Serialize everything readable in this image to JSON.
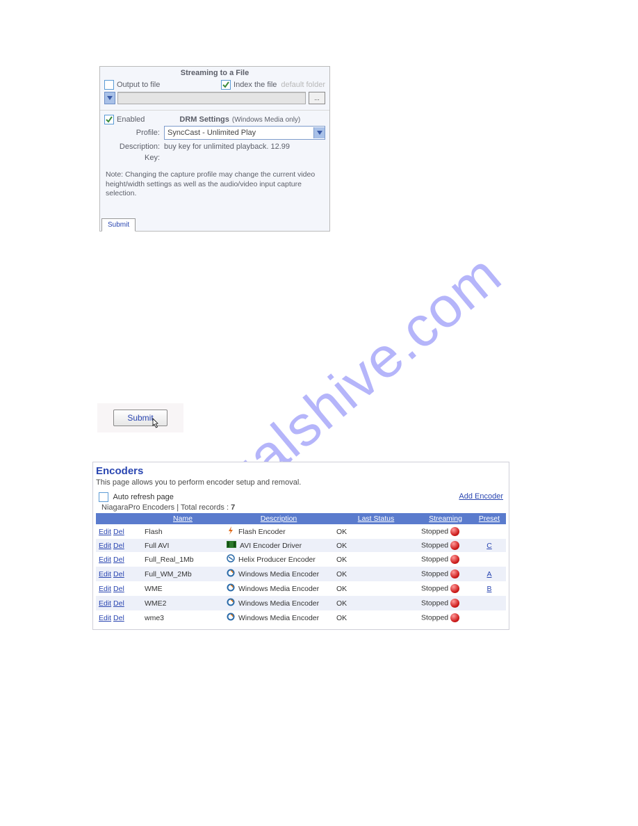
{
  "watermark": "manualshive.com",
  "streamPanel": {
    "title": "Streaming to a File",
    "outputToFile": {
      "label": "Output to file",
      "checked": false
    },
    "indexFile": {
      "label": "Index the file",
      "checked": true
    },
    "defaultFolder": "default folder",
    "browseLabel": "...",
    "enabled": {
      "label": "Enabled",
      "checked": true
    },
    "drmTitle": "DRM Settings",
    "drmSub": "(Windows Media only)",
    "profileLabel": "Profile:",
    "profileValue": "SyncCast - Unlimited Play",
    "descLabel": "Description:",
    "descValue": "buy key for unlimited playback. 12.99",
    "keyLabel": "Key:",
    "keyValue": "",
    "note": "Note: Changing the capture profile may change the current video height/width settings as well as the audio/video input capture selection.",
    "submit": "Submit"
  },
  "submitBtn": {
    "label": "Submit"
  },
  "encodersPanel": {
    "title": "Encoders",
    "subtitle": "This page allows you to perform encoder setup and removal.",
    "autoRefresh": "Auto refresh page",
    "addEncoder": "Add Encoder",
    "totalsPrefix": "NiagaraPro Encoders | Total records : ",
    "totalRecords": "7",
    "headers": {
      "name": "Name",
      "description": "Description",
      "lastStatus": "Last Status",
      "streaming": "Streaming",
      "preset": "Preset"
    },
    "rowActions": {
      "edit": "Edit",
      "del": "Del"
    },
    "streamingStatus": "Stopped",
    "rows": [
      {
        "name": "Flash",
        "driver": "Flash Encoder",
        "icon": "flash",
        "status": "OK",
        "preset": ""
      },
      {
        "name": "Full AVI",
        "driver": "AVI Encoder Driver",
        "icon": "avi",
        "status": "OK",
        "preset": "C"
      },
      {
        "name": "Full_Real_1Mb",
        "driver": "Helix Producer Encoder",
        "icon": "helix",
        "status": "OK",
        "preset": ""
      },
      {
        "name": "Full_WM_2Mb",
        "driver": "Windows Media Encoder",
        "icon": "wme",
        "status": "OK",
        "preset": "A"
      },
      {
        "name": "WME",
        "driver": "Windows Media Encoder",
        "icon": "wme",
        "status": "OK",
        "preset": "B"
      },
      {
        "name": "WME2",
        "driver": "Windows Media Encoder",
        "icon": "wme",
        "status": "OK",
        "preset": ""
      },
      {
        "name": "wme3",
        "driver": "Windows Media Encoder",
        "icon": "wme",
        "status": "OK",
        "preset": ""
      }
    ]
  }
}
